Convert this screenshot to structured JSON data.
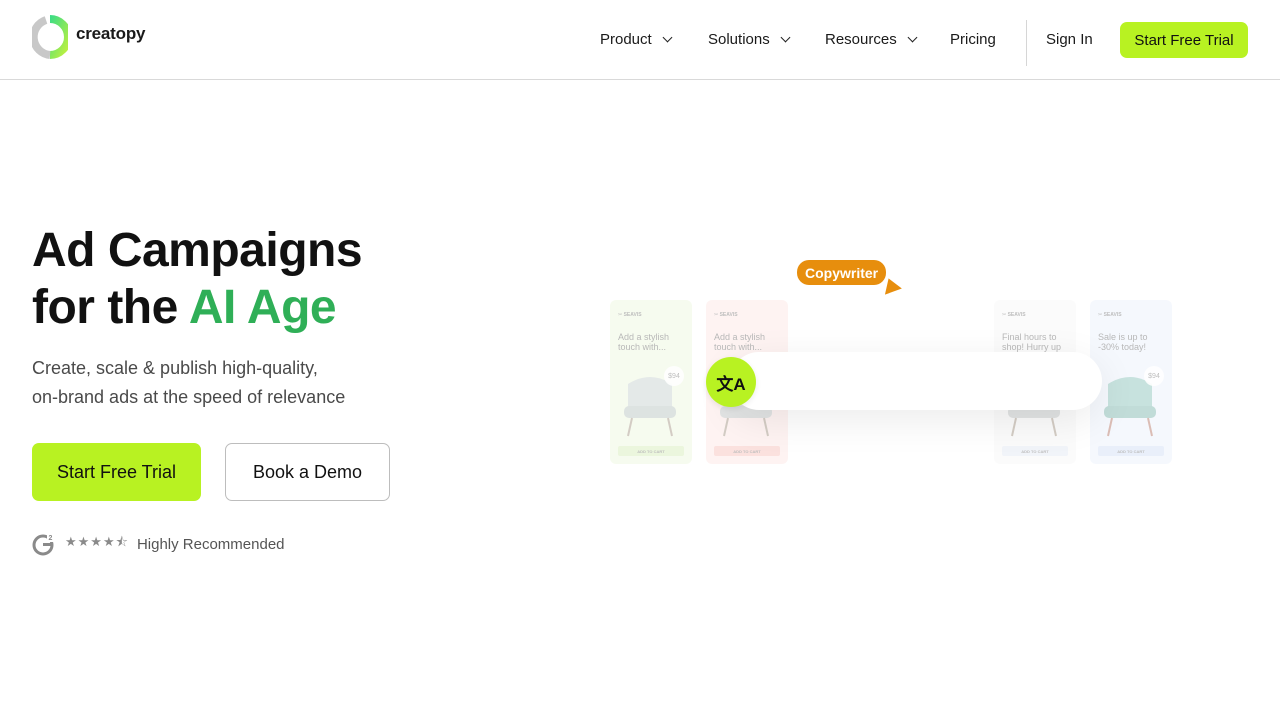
{
  "header": {
    "logo_text": "creatopy",
    "nav": [
      {
        "label": "Product",
        "dropdown": true
      },
      {
        "label": "Solutions",
        "dropdown": true
      },
      {
        "label": "Resources",
        "dropdown": true
      },
      {
        "label": "Pricing",
        "dropdown": false
      }
    ],
    "sign_in": "Sign In",
    "cta": "Start Free Trial"
  },
  "hero": {
    "title_line1": "Ad Campaigns",
    "title_line2_prefix": "for the ",
    "title_line2_highlight": "AI Age",
    "subtitle_line1": "Create, scale & publish high-quality,",
    "subtitle_line2": "on-brand ads at the speed of relevance",
    "primary_button": "Start Free Trial",
    "secondary_button": "Book a Demo",
    "rating_label": "Highly Recommended",
    "rating_stars": "★★★★⯪"
  },
  "illustration": {
    "tag": "Copywriter",
    "translate_icon": "文A",
    "cards": [
      {
        "brand": "✂ SEAVIS",
        "copy": "Add a stylish touch with...",
        "price": "$94",
        "cta": "ADD TO CART",
        "bg": "#eaf6d6",
        "cta_bg": "#cde9a7"
      },
      {
        "brand": "✂ SEAVIS",
        "copy": "Add a stylish touch with...",
        "price": "$94",
        "cta": "ADD TO CART",
        "bg": "#fde2df",
        "cta_bg": "#f7b3ab"
      },
      {
        "brand": "✂ SEAVIS",
        "copy": "Final hours to shop! Hurry up",
        "price": "",
        "cta": "ADD TO CART",
        "bg": "#f5f5f5",
        "cta_bg": "#dde3f0"
      },
      {
        "brand": "✂ SEAVIS",
        "copy": "Sale is up to -30% today!",
        "price": "$94",
        "cta": "ADD TO CART",
        "bg": "#e6eefc",
        "cta_bg": "#c6d6f3"
      }
    ]
  },
  "colors": {
    "accent_lime": "#b8f222",
    "title_green": "#2faf57",
    "tag_orange": "#e78e0d"
  }
}
